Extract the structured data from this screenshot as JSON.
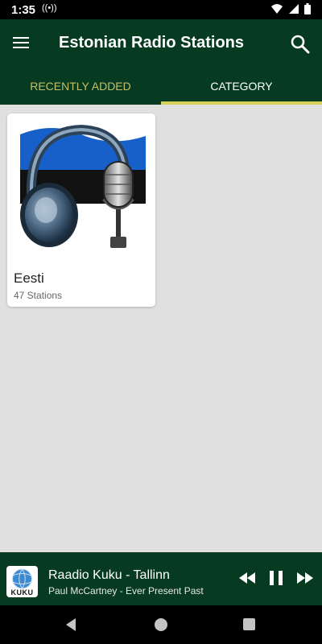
{
  "status": {
    "time": "1:35"
  },
  "app_bar": {
    "title": "Estonian Radio Stations"
  },
  "tabs": [
    {
      "label": "RECENTLY ADDED"
    },
    {
      "label": "CATEGORY",
      "selected": true
    }
  ],
  "categories": [
    {
      "name": "Eesti",
      "count": "47 Stations",
      "image_icon": "headphones-microphone-flag"
    }
  ],
  "player": {
    "logo_text": "KUKU",
    "station": "Raadio Kuku - Tallinn",
    "track": "Paul McCartney - Ever Present Past"
  },
  "colors": {
    "primary": "#063b21",
    "accent": "#d7ce5a",
    "tab_inactive": "#c5bf69",
    "background": "#e0e0e0"
  }
}
